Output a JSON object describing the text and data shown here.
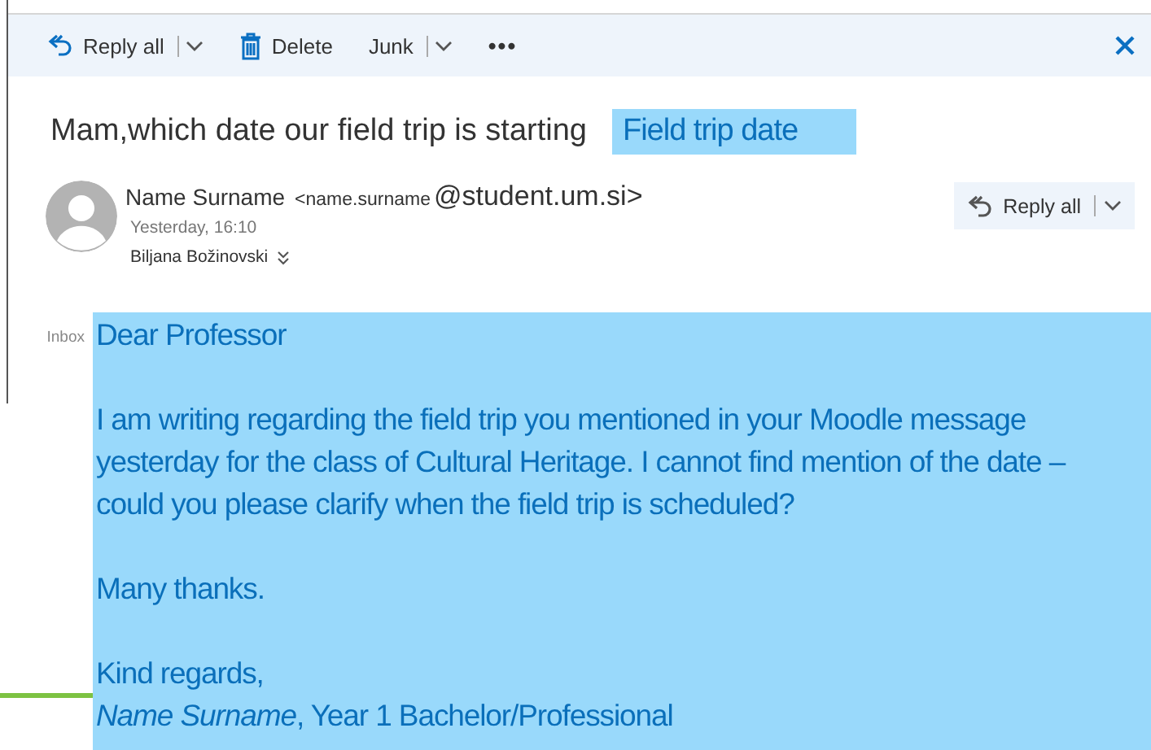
{
  "toolbar": {
    "actions": [
      {
        "kind": "reply",
        "label": "Reply all",
        "menu": true
      },
      {
        "kind": "delete",
        "label": "Delete",
        "menu": false
      },
      {
        "kind": "plain",
        "label": "Junk",
        "menu": true
      },
      {
        "kind": "plain",
        "label": "•••",
        "menu": false
      }
    ],
    "close": true
  },
  "subject": {
    "text": "Mam,which date our field trip is starting",
    "tag": "Field trip date"
  },
  "header": {
    "sender_name": "Name Surname",
    "sender_user": "<name.surname",
    "sender_domain": "@student.um.si>",
    "time": "Yesterday, 16:10",
    "recipient": "Biljana Božinovski",
    "reply": {
      "label": "Reply all",
      "menu": true
    }
  },
  "body": {
    "folder": "Inbox",
    "paragraphs": [
      {
        "lines": [
          "Dear Professor"
        ]
      },
      {
        "lines": [
          "I am writing regarding the field trip you mentioned in your Moodle message yesterday for the class of Cultural Heritage. I cannot find mention of the date – could you please clarify when the field trip is scheduled?"
        ]
      },
      {
        "lines": [
          "Many thanks."
        ]
      },
      {
        "lines": [
          "Kind regards,",
          "*Name Surname*, Year 1 Bachelor/Professional"
        ]
      }
    ]
  }
}
